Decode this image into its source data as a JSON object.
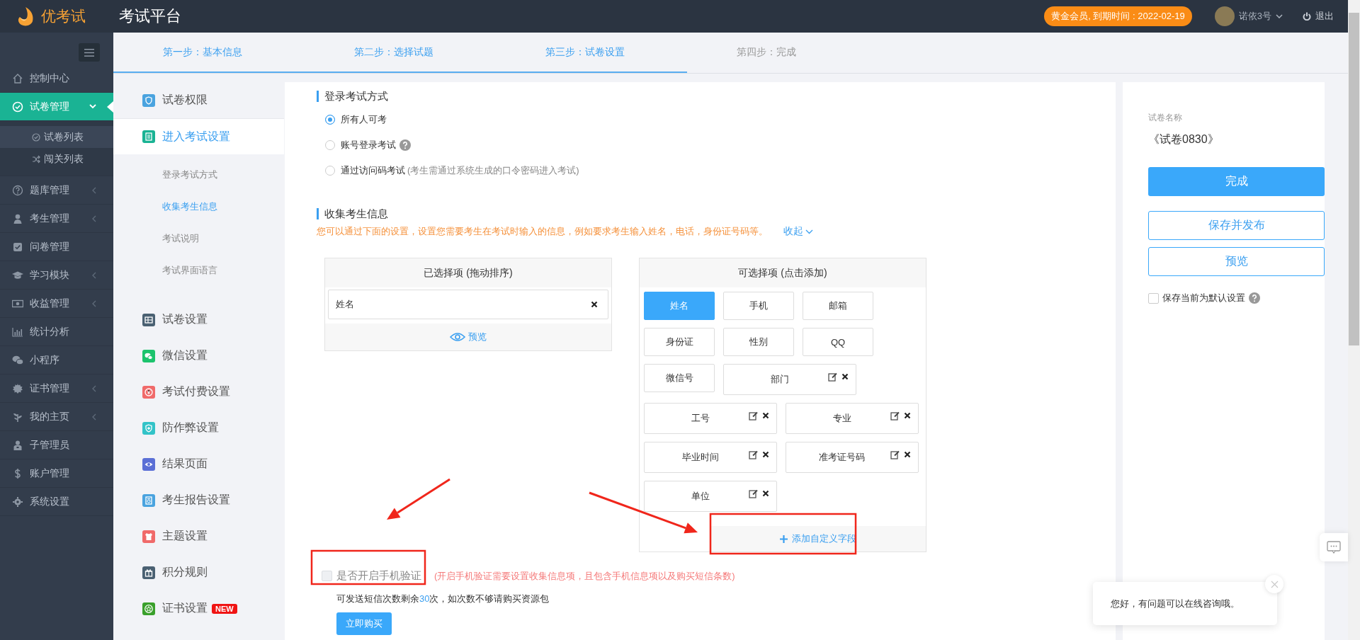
{
  "header": {
    "logo_text": "优考试",
    "title": "考试平台",
    "membership": "黄金会员, 到期时间 : 2022-02-19",
    "user": "诺依3号",
    "logout": "退出"
  },
  "sidebar": {
    "items": [
      {
        "label": "控制中心",
        "selected": false
      },
      {
        "label": "试卷管理",
        "selected": true,
        "expanded": true,
        "children": [
          {
            "label": "试卷列表",
            "selected": true
          },
          {
            "label": "闯关列表",
            "selected": false
          }
        ]
      },
      {
        "label": "题库管理",
        "selected": false,
        "expanded": false
      },
      {
        "label": "考生管理",
        "selected": false,
        "expanded": false
      },
      {
        "label": "问卷管理",
        "selected": false
      },
      {
        "label": "学习模块",
        "selected": false,
        "expanded": false
      },
      {
        "label": "收益管理",
        "selected": false,
        "expanded": false
      },
      {
        "label": "统计分析",
        "selected": false
      },
      {
        "label": "小程序",
        "selected": false
      },
      {
        "label": "证书管理",
        "selected": false,
        "expanded": false
      },
      {
        "label": "我的主页",
        "selected": false,
        "expanded": false
      },
      {
        "label": "子管理员",
        "selected": false
      },
      {
        "label": "账户管理",
        "selected": false
      },
      {
        "label": "系统设置",
        "selected": false
      }
    ]
  },
  "steps": [
    {
      "label": "第一步：基本信息",
      "reached": true
    },
    {
      "label": "第二步：选择试题",
      "reached": true
    },
    {
      "label": "第三步：试卷设置",
      "reached": true
    },
    {
      "label": "第四步：完成",
      "reached": false
    }
  ],
  "settings_nav": [
    {
      "label": "试卷权限",
      "selected": false
    },
    {
      "label": "进入考试设置",
      "selected": true,
      "children": [
        {
          "label": "登录考试方式",
          "selected": false
        },
        {
          "label": "收集考生信息",
          "selected": true
        },
        {
          "label": "考试说明",
          "selected": false
        },
        {
          "label": "考试界面语言",
          "selected": false
        }
      ]
    },
    {
      "label": "试卷设置",
      "selected": false
    },
    {
      "label": "微信设置",
      "selected": false
    },
    {
      "label": "考试付费设置",
      "selected": false
    },
    {
      "label": "防作弊设置",
      "selected": false
    },
    {
      "label": "结果页面",
      "selected": false
    },
    {
      "label": "考生报告设置",
      "selected": false
    },
    {
      "label": "主题设置",
      "selected": false
    },
    {
      "label": "积分规则",
      "selected": false
    },
    {
      "label": "证书设置",
      "selected": false,
      "badge": "NEW"
    }
  ],
  "login_section": {
    "title": "登录考试方式",
    "options": [
      {
        "label": "所有人可考",
        "selected": true
      },
      {
        "label": "账号登录考试",
        "selected": false,
        "help": true
      },
      {
        "label": "通过访问码考试",
        "selected": false,
        "note": "(考生需通过系统生成的口令密码进入考试)"
      }
    ]
  },
  "collect_section": {
    "title": "收集考生信息",
    "hint": "您可以通过下面的设置，设置您需要考生在考试时输入的信息，例如要求考生输入姓名，电话，身份证号码等。",
    "collapse": "收起",
    "chosen": {
      "title": "已选择项 (拖动排序)",
      "items": [
        {
          "label": "姓名"
        }
      ],
      "preview": "预览"
    },
    "available": {
      "title": "可选择项 (点击添加)",
      "items": [
        {
          "label": "姓名",
          "kind": "preset",
          "selected": true
        },
        {
          "label": "手机",
          "kind": "preset",
          "selected": false
        },
        {
          "label": "邮箱",
          "kind": "preset",
          "selected": false
        },
        {
          "label": "身份证",
          "kind": "preset",
          "selected": false
        },
        {
          "label": "性别",
          "kind": "preset",
          "selected": false
        },
        {
          "label": "QQ",
          "kind": "preset",
          "selected": false
        },
        {
          "label": "微信号",
          "kind": "preset",
          "selected": false
        },
        {
          "label": "部门",
          "kind": "custom",
          "selected": false
        },
        {
          "label": "工号",
          "kind": "custom",
          "selected": false
        },
        {
          "label": "专业",
          "kind": "custom",
          "selected": false
        },
        {
          "label": "毕业时间",
          "kind": "custom",
          "selected": false
        },
        {
          "label": "准考证号码",
          "kind": "custom",
          "selected": false
        },
        {
          "label": "单位",
          "kind": "custom",
          "selected": false
        }
      ],
      "add_custom": "添加自定义字段"
    }
  },
  "phone_verify": {
    "label": "是否开启手机验证",
    "checked": false,
    "disabled": true,
    "hint": "(开启手机验证需要设置收集信息项，且包含手机信息项以及购买短信条数)"
  },
  "sms": {
    "prefix": "可发送短信次数剩余",
    "count": "30",
    "suffix": "次，如次数不够请购买资源包",
    "buy_button": "立即购买"
  },
  "summary": {
    "name_label": "试卷名称",
    "name": "《试卷0830》",
    "finish": "完成",
    "save_publish": "保存并发布",
    "preview": "预览",
    "default_checkbox": {
      "label": "保存当前为默认设置",
      "checked": false,
      "help": true
    }
  },
  "chat": {
    "message": "您好，有问题可以在线咨询哦。"
  },
  "annotations": [
    {
      "kind": "arrow"
    },
    {
      "kind": "arrow"
    },
    {
      "kind": "highlight_box"
    },
    {
      "kind": "highlight_box"
    }
  ]
}
